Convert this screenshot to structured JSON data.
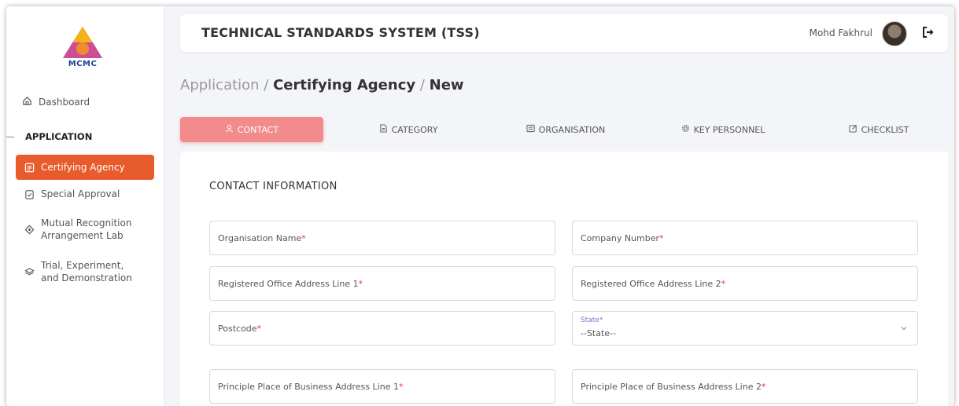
{
  "brand": {
    "logo_text": "MCMC"
  },
  "sidebar": {
    "dashboard_label": "Dashboard",
    "section_label": "APPLICATION",
    "items": [
      {
        "label": "Certifying Agency",
        "icon": "list-icon",
        "active": true
      },
      {
        "label": "Special Approval",
        "icon": "clipboard-icon",
        "active": false
      },
      {
        "label": "Mutual Recognition Arrangement Lab",
        "icon": "diamond-icon",
        "active": false
      },
      {
        "label": "Trial, Experiment, and Demonstration",
        "icon": "layers-icon",
        "active": false
      }
    ]
  },
  "header": {
    "title": "TECHNICAL STANDARDS SYSTEM (TSS)",
    "user_name": "Mohd Fakhrul"
  },
  "breadcrumb": {
    "part1": "Application",
    "sep1": " / ",
    "part2": "Certifying Agency",
    "sep2": " / ",
    "part3": "New"
  },
  "tabs": [
    {
      "label": "CONTACT",
      "icon": "user-icon",
      "active": true
    },
    {
      "label": "CATEGORY",
      "icon": "document-icon",
      "active": false
    },
    {
      "label": "ORGANISATION",
      "icon": "list-icon",
      "active": false
    },
    {
      "label": "KEY PERSONNEL",
      "icon": "gear-icon",
      "active": false
    },
    {
      "label": "CHECKLIST",
      "icon": "edit-icon",
      "active": false
    }
  ],
  "form": {
    "section_title": "CONTACT INFORMATION",
    "fields": {
      "org_name": "Organisation Name",
      "company_number": "Company Number",
      "address1": "Registered Office Address Line 1",
      "address2": "Registered Office Address Line 2",
      "postcode": "Postcode",
      "state_label": "State",
      "state_value": "--State--",
      "ppb1": "Principle Place of Business Address Line 1",
      "ppb2": "Principle Place of Business Address Line 2"
    },
    "required_mark": "*"
  },
  "colors": {
    "accent": "#e85b2c",
    "tab_active": "#f28b8b",
    "required": "#e53935"
  }
}
